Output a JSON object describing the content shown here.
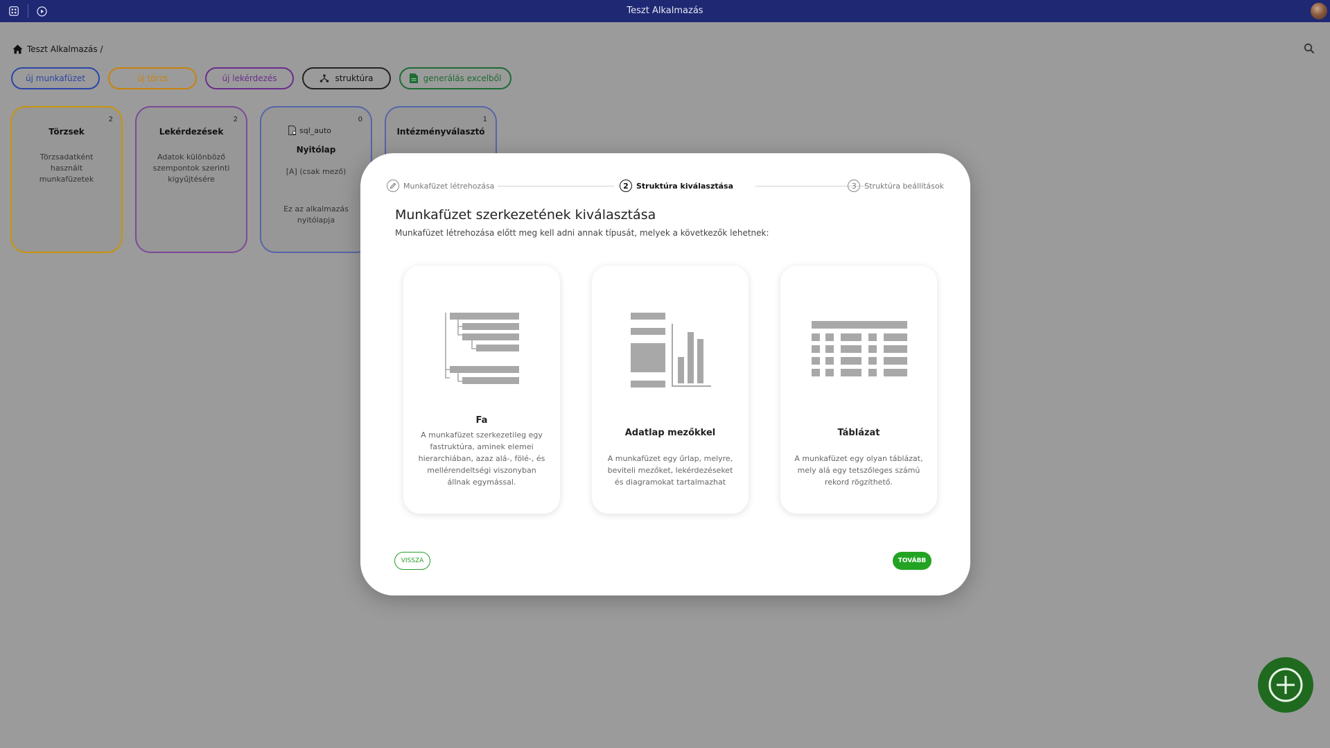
{
  "app": {
    "title": "Teszt Alkalmazás"
  },
  "breadcrumb": {
    "text": "Teszt Alkalmazás /"
  },
  "toolbar": {
    "new_workbook": "új munkafüzet",
    "new_master": "új törzs",
    "new_query": "új lekérdezés",
    "structure": "struktúra",
    "generate_excel": "generálás excelből"
  },
  "cards": [
    {
      "count": "2",
      "title": "Törzsek",
      "desc": "Törzsadatként használt munkafüzetek"
    },
    {
      "count": "2",
      "title": "Lekérdezések",
      "desc": "Adatok különböző szempontok szerinti kigyűjtésére"
    },
    {
      "count": "0",
      "sql": "sql_auto",
      "title": "Nyitólap",
      "sub": "[A] (csak mező)",
      "desc": "Ez az alkalmazás nyitólapja"
    },
    {
      "count": "1",
      "title": "Intézményválasztó"
    }
  ],
  "modal": {
    "steps": [
      {
        "label": "Munkafüzet létrehozása"
      },
      {
        "num": "2",
        "label": "Struktúra kiválasztása"
      },
      {
        "num": "3",
        "label": "Struktúra beállítások"
      }
    ],
    "title": "Munkafüzet szerkezetének kiválasztása",
    "subtitle": "Munkafüzet létrehozása előtt meg kell adni annak típusát, melyek a következők lehetnek:",
    "options": [
      {
        "title": "Fa",
        "desc": "A munkafüzet szerkezetileg egy fastruktúra, aminek elemei hierarchiában, azaz alá-, fölé-, és mellérendeltségi viszonyban állnak egymással.",
        "icon": "tree-structure-icon"
      },
      {
        "title": "Adatlap mezőkkel",
        "desc": "A munkafüzet egy űrlap, melyre, beviteli mezőket, lekérdezéseket és diagramokat tartalmazhat",
        "icon": "form-chart-icon"
      },
      {
        "title": "Táblázat",
        "desc": "A munkafüzet egy olyan táblázat, mely alá egy tetszőleges számú rekord rögzíthető.",
        "icon": "table-grid-icon"
      }
    ],
    "back_label": "VISSZA",
    "next_label": "TOVÁBB"
  }
}
